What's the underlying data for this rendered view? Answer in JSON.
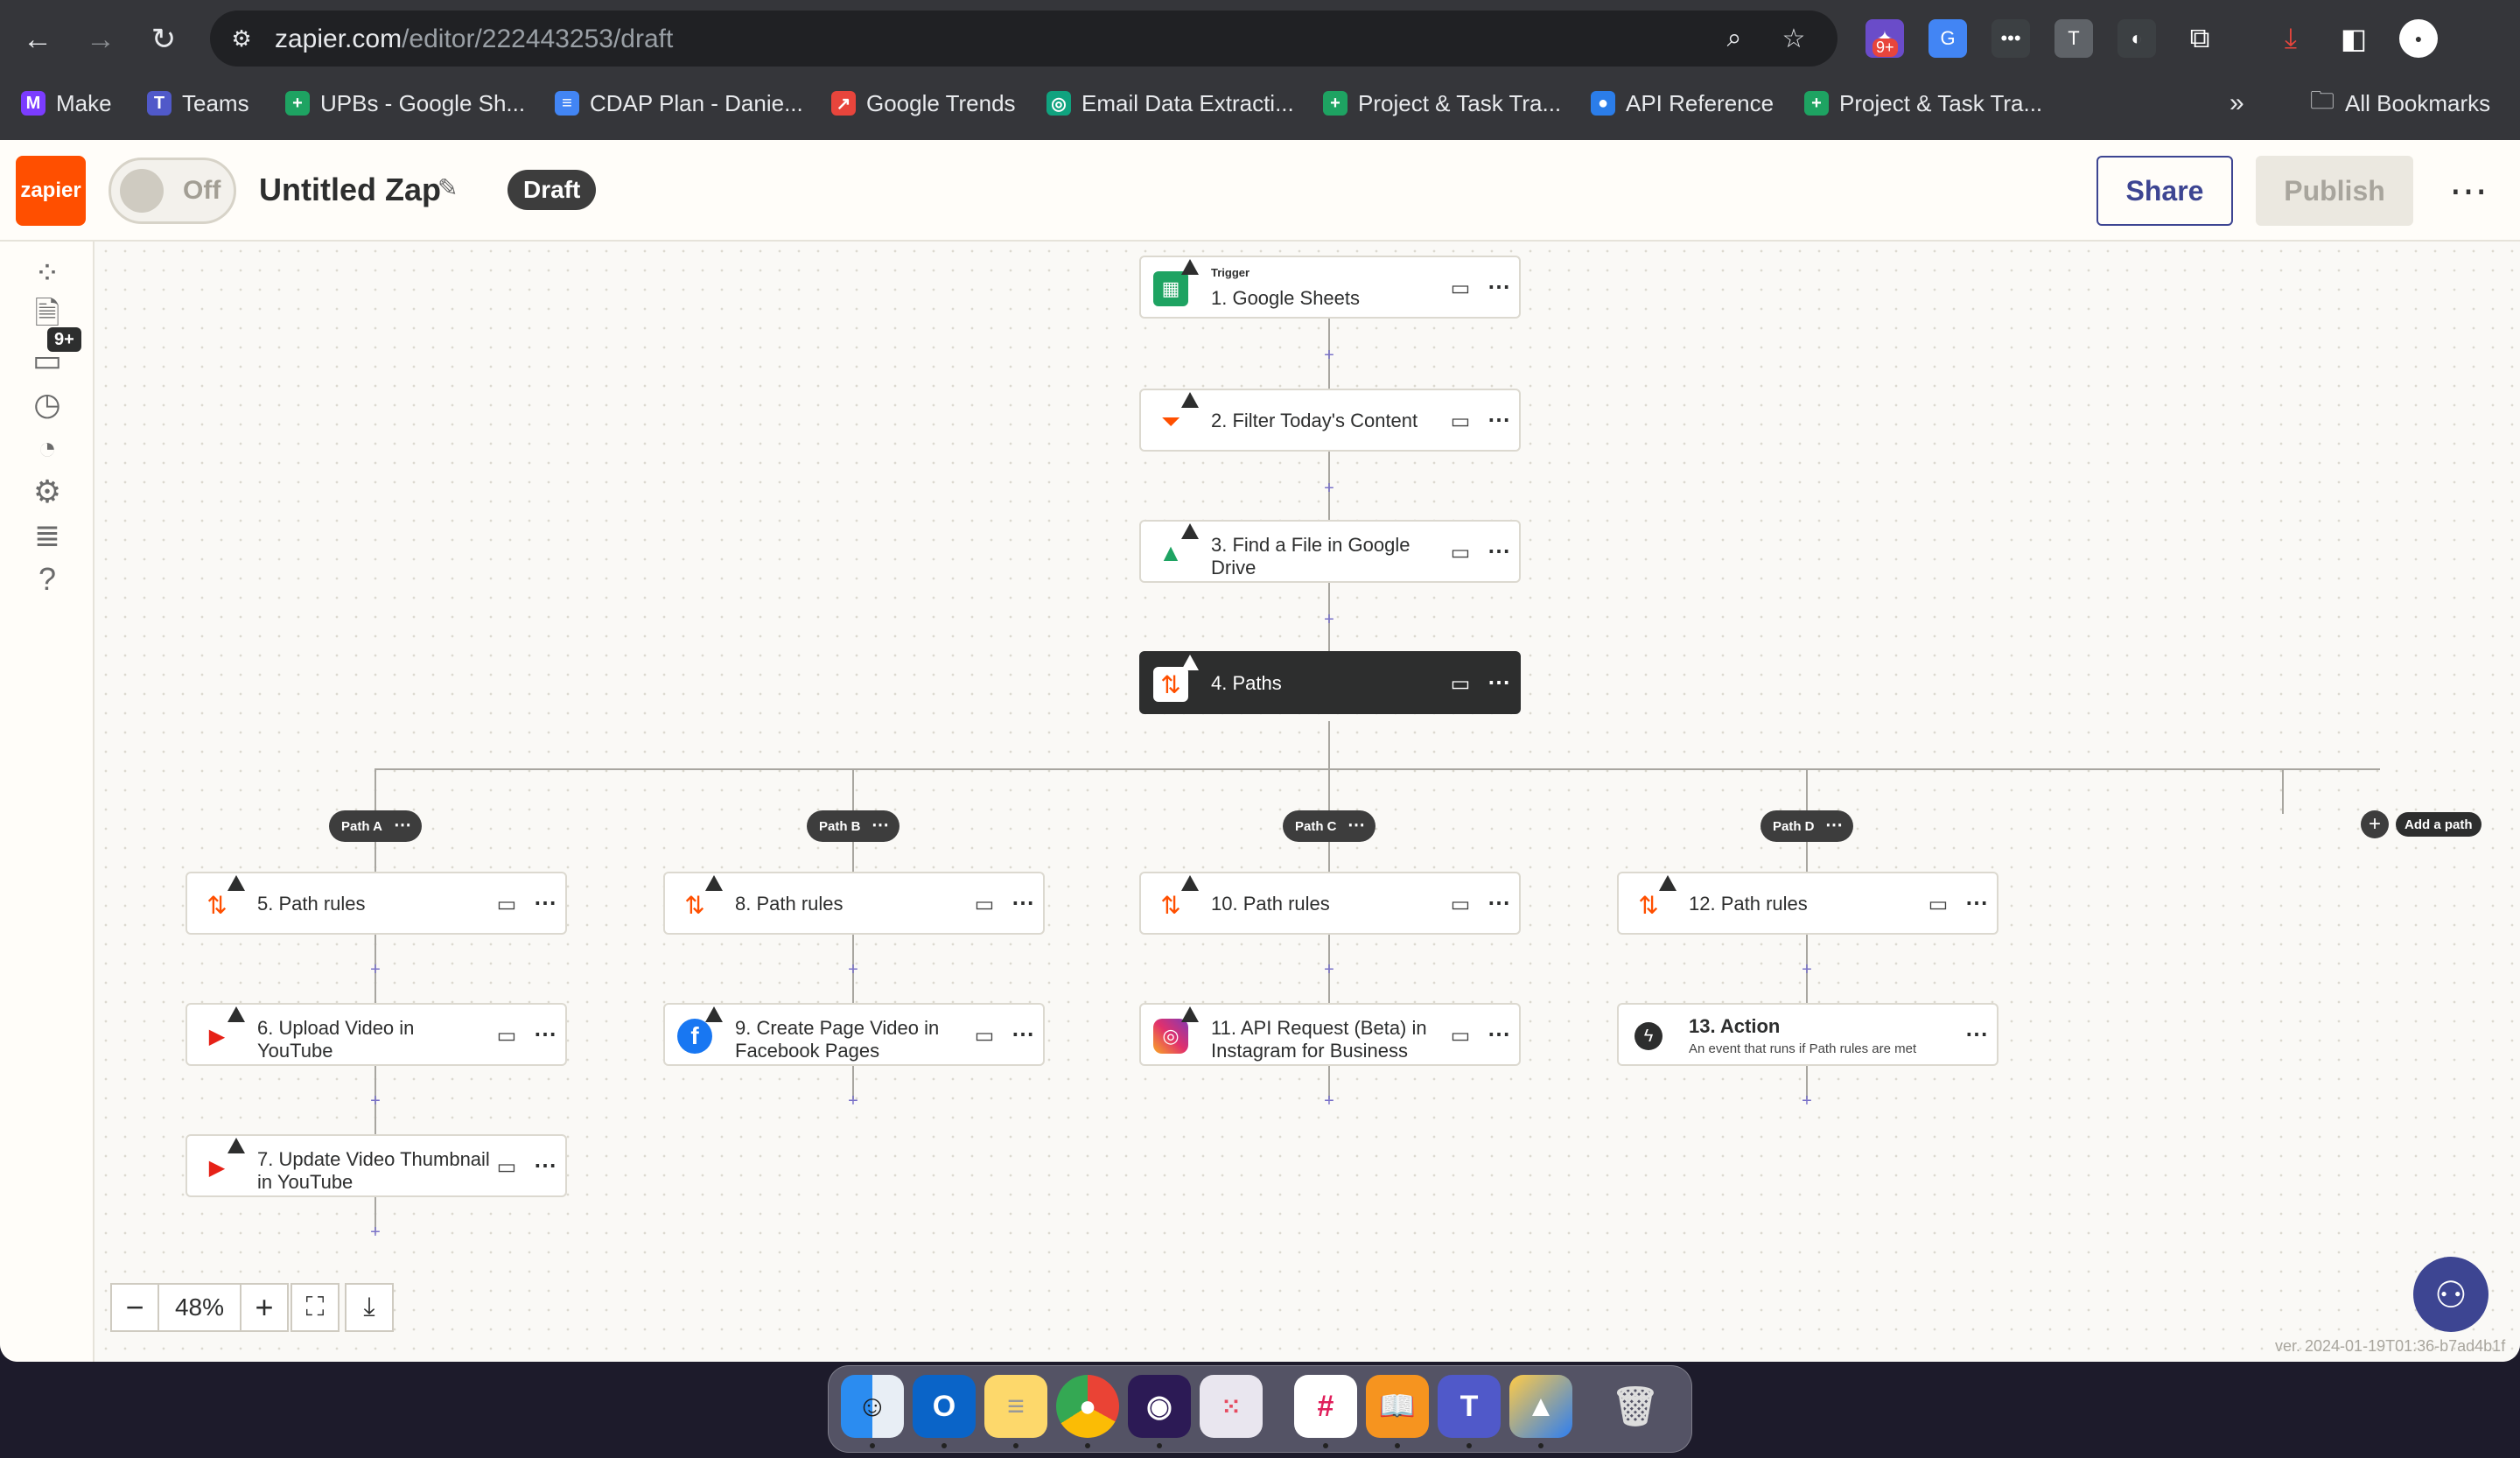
{
  "browser": {
    "url_host": "zapier.com",
    "url_path": "/editor/222443253/draft",
    "extension_badge": "9+",
    "bookmarks": [
      {
        "label": "Make",
        "color": "#7b3cff",
        "icon": "M"
      },
      {
        "label": "Teams",
        "color": "#5059c9",
        "icon": "T"
      },
      {
        "label": "UPBs - Google Sh...",
        "color": "#1ea362",
        "icon": "+"
      },
      {
        "label": "CDAP Plan - Danie...",
        "color": "#4285f4",
        "icon": "≡"
      },
      {
        "label": "Google Trends",
        "color": "#e8453c",
        "icon": "↗"
      },
      {
        "label": "Email Data Extracti...",
        "color": "#10a37f",
        "icon": "◎"
      },
      {
        "label": "Project & Task Tra...",
        "color": "#1ea362",
        "icon": "+"
      },
      {
        "label": "API Reference",
        "color": "#2b7de9",
        "icon": "●"
      },
      {
        "label": "Project & Task Tra...",
        "color": "#1ea362",
        "icon": "+"
      }
    ],
    "all_bookmarks": "All Bookmarks"
  },
  "header": {
    "logo": "zapier",
    "toggle_label": "Off",
    "zap_title": "Untitled Zap",
    "status_badge": "Draft",
    "share": "Share",
    "publish": "Publish"
  },
  "sidebar": {
    "badge": "9+"
  },
  "steps": {
    "s1": {
      "eyebrow": "Trigger",
      "title": "1. Google Sheets"
    },
    "s2": {
      "title": "2. Filter Today's Content"
    },
    "s3": {
      "title": "3. Find a File in Google Drive"
    },
    "s4": {
      "title": "4. Paths"
    },
    "s5": {
      "title": "5. Path rules"
    },
    "s6": {
      "title": "6. Upload Video in YouTube"
    },
    "s7": {
      "title": "7. Update Video Thumbnail in YouTube"
    },
    "s8": {
      "title": "8. Path rules"
    },
    "s9": {
      "title": "9. Create Page Video in Facebook Pages"
    },
    "s10": {
      "title": "10. Path rules"
    },
    "s11": {
      "title": "11. API Request (Beta) in Instagram for Business"
    },
    "s12": {
      "title": "12. Path rules"
    },
    "s13": {
      "title": "13. Action",
      "subtitle": "An event that runs if Path rules are met"
    }
  },
  "paths": {
    "a": "Path A",
    "b": "Path B",
    "c": "Path C",
    "d": "Path D",
    "add": "Add a path"
  },
  "zoom": {
    "value": "48%"
  },
  "version": "ver. 2024-01-19T01:36-b7ad4b1f"
}
